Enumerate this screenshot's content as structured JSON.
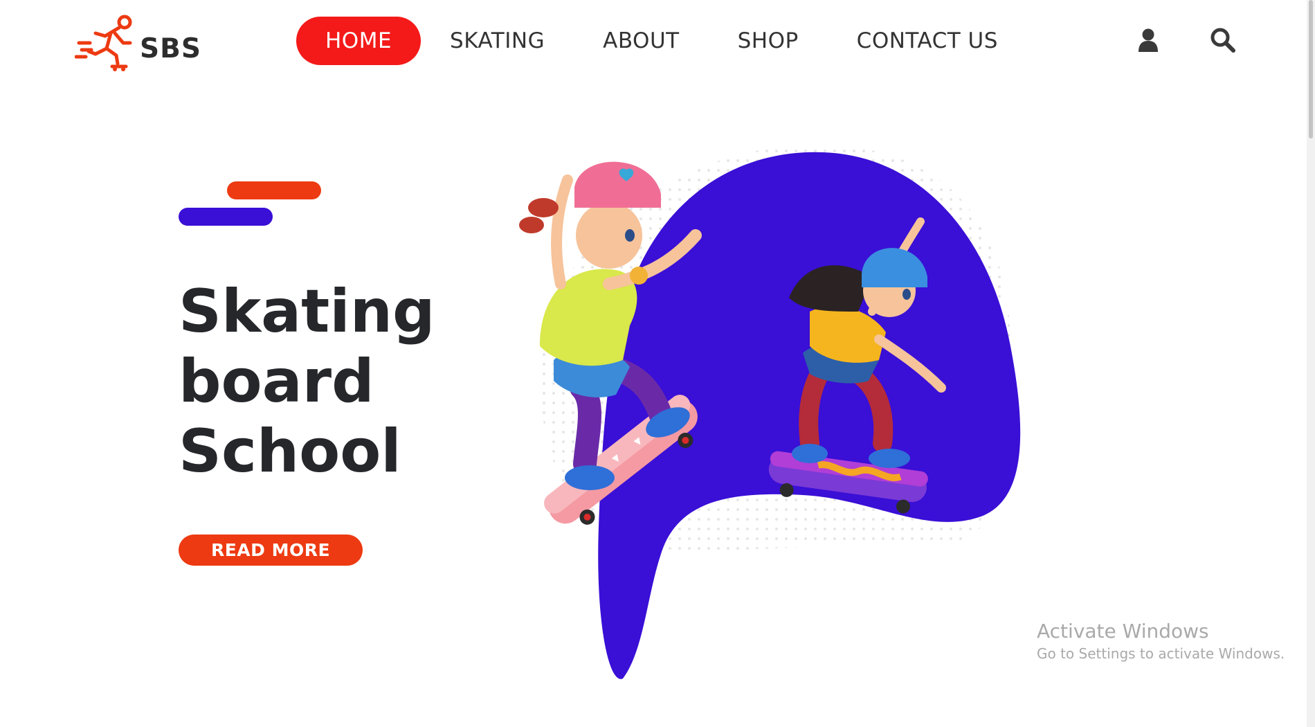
{
  "brand": {
    "name": "SBS",
    "logo_icon": "skater-logo-icon",
    "accent": "#f41a1a"
  },
  "nav": {
    "items": [
      {
        "label": "HOME",
        "active": true
      },
      {
        "label": "SKATING",
        "active": false
      },
      {
        "label": "ABOUT",
        "active": false
      },
      {
        "label": "SHOP",
        "active": false
      },
      {
        "label": "CONTACT US",
        "active": false
      }
    ]
  },
  "header_icons": [
    "user-icon",
    "search-icon"
  ],
  "hero": {
    "title_lines": [
      "Skating",
      "board",
      "School"
    ],
    "cta_label": "READ MORE",
    "bar_colors": {
      "orange": "#ed3a12",
      "purple": "#3a0fd6"
    },
    "blob_color": "#3a0fd6"
  },
  "watermark": {
    "title": "Activate Windows",
    "subtitle": "Go to Settings to activate Windows."
  }
}
